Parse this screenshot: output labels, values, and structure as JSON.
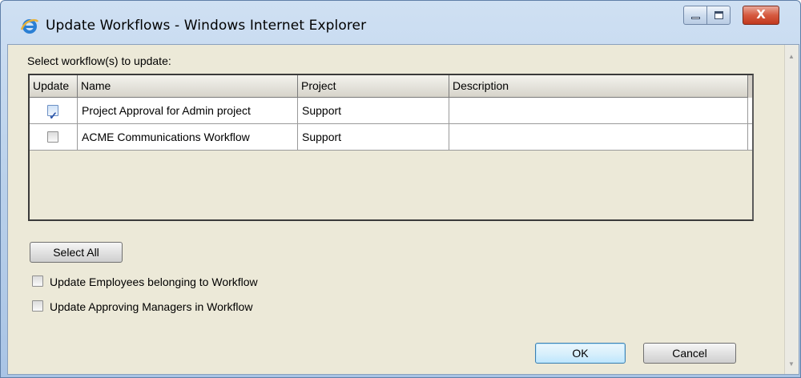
{
  "window": {
    "title": "Update Workflows - Windows Internet Explorer",
    "close_glyph": "X"
  },
  "dialog": {
    "prompt": "Select workflow(s) to update:",
    "columns": [
      "Update",
      "Name",
      "Project",
      "Description"
    ],
    "rows": [
      {
        "checked": true,
        "name": "Project Approval for Admin project",
        "project": "Support",
        "description": ""
      },
      {
        "checked": false,
        "name": "ACME Communications Workflow",
        "project": "Support",
        "description": ""
      }
    ],
    "select_all_label": "Select All",
    "options": [
      {
        "label": "Update Employees belonging to Workflow",
        "checked": false
      },
      {
        "label": "Update Approving Managers in Workflow",
        "checked": false
      }
    ],
    "ok_label": "OK",
    "cancel_label": "Cancel"
  },
  "icons": {
    "check_glyph": "✓",
    "scroll_up_glyph": "▲",
    "scroll_down_glyph": "▼"
  }
}
